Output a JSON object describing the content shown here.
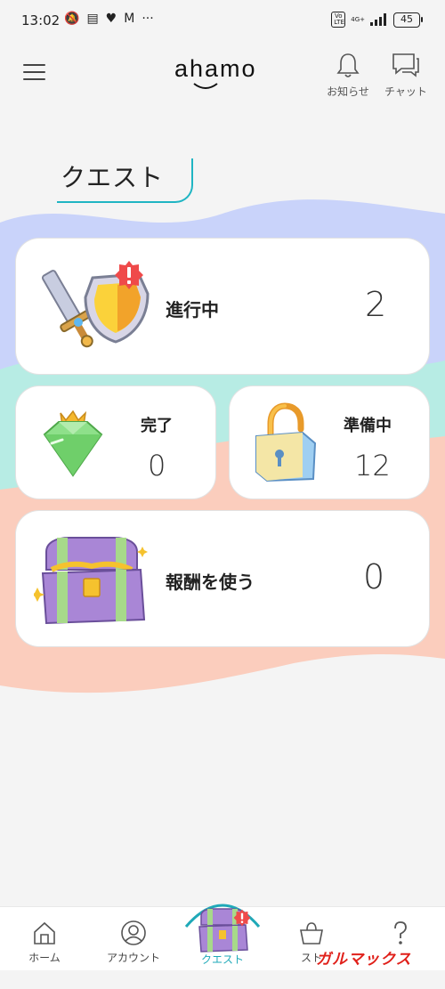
{
  "statusbar": {
    "time": "13:02",
    "battery": "45",
    "network": "4G+"
  },
  "header": {
    "logo": "ahamo",
    "notice_label": "お知らせ",
    "chat_label": "チャット"
  },
  "page_title": "クエスト",
  "cards": {
    "in_progress": {
      "label": "進行中",
      "count": "2"
    },
    "completed": {
      "label": "完了",
      "count": "0"
    },
    "preparing": {
      "label": "準備中",
      "count": "12"
    },
    "rewards": {
      "label": "報酬を使う",
      "count": "0"
    }
  },
  "bottom_nav": {
    "items": [
      {
        "label": "ホーム",
        "icon": "home-icon"
      },
      {
        "label": "アカウント",
        "icon": "account-icon"
      },
      {
        "label": "クエスト",
        "icon": "quest-icon"
      },
      {
        "label": "スト",
        "icon": "store-icon"
      },
      {
        "label": "",
        "icon": "help-icon"
      }
    ]
  },
  "watermark": "ガルマックス",
  "colors": {
    "accent": "#1fb5c3",
    "wave_blue": "#c9d3fa",
    "wave_mint": "#b7ece4",
    "wave_peach": "#fbcdbd",
    "badge_red": "#ef4a4a"
  }
}
